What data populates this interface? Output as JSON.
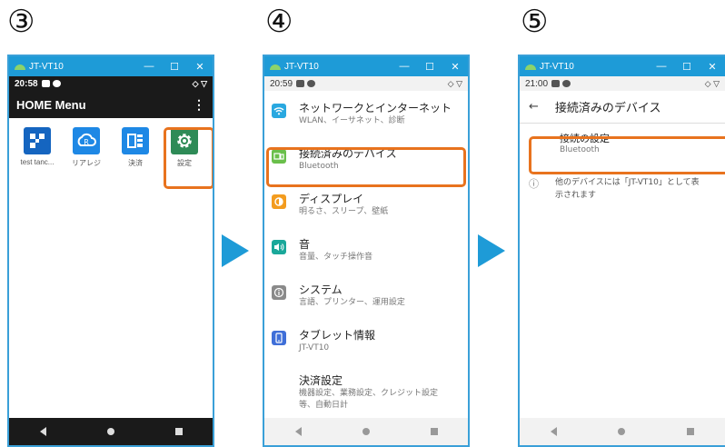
{
  "steps": [
    "③",
    "④",
    "⑤"
  ],
  "window": {
    "title": "JT-VT10",
    "minimize": "—",
    "maximize": "☐",
    "close": "✕"
  },
  "phone3": {
    "time": "20:58",
    "status_right": "◇ ▽",
    "home_title": "HOME Menu",
    "menu_glyph": "⋮",
    "apps": [
      {
        "label": "test tanc...",
        "color": "#1565c0"
      },
      {
        "label": "リアレジ",
        "color": "#1e88e5"
      },
      {
        "label": "決済",
        "color": "#1e88e5"
      },
      {
        "label": "設定",
        "color": "#2e8b57"
      }
    ],
    "nav": [
      "◀",
      "●",
      "■"
    ]
  },
  "phone4": {
    "time": "20:59",
    "status_right": "◇ ▽",
    "items": [
      {
        "title": "ネットワークとインターネット",
        "sub": "WLAN、イーサネット、診断",
        "color": "#29a8e0",
        "icon": "wifi-icon"
      },
      {
        "title": "接続済みのデバイス",
        "sub": "Bluetooth",
        "color": "#6abf4b",
        "icon": "devices-icon"
      },
      {
        "title": "ディスプレイ",
        "sub": "明るさ、スリープ、壁紙",
        "color": "#f39c1f",
        "icon": "brightness-icon"
      },
      {
        "title": "音",
        "sub": "音量、タッチ操作音",
        "color": "#1aa89a",
        "icon": "volume-icon"
      },
      {
        "title": "システム",
        "sub": "言語、プリンター、運用設定",
        "color": "#8a8a8a",
        "icon": "info-icon"
      },
      {
        "title": "タブレット情報",
        "sub": "JT-VT10",
        "color": "#3f6fd8",
        "icon": "tablet-icon"
      },
      {
        "title": "決済設定",
        "sub": "機器設定、業務設定、クレジット設定等、自動日計",
        "color": "",
        "icon": ""
      }
    ]
  },
  "phone5": {
    "time": "21:00",
    "status_right": "◇ ▽",
    "header": "接続済みのデバイス",
    "back_glyph": "←",
    "item_title": "接続の設定",
    "item_sub": "Bluetooth",
    "info_glyph": "ⓘ",
    "info_text": "他のデバイスには「JT-VT10」として表示されます"
  },
  "colors": {
    "accent": "#1e9bd7",
    "highlight": "#e8731e"
  }
}
